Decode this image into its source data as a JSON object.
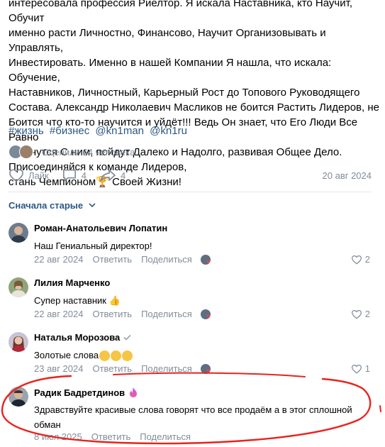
{
  "post": {
    "lines": [
      "интересовала профессия Риелтор. Я искала Наставника, кто Научит, Обучит",
      "именно расти Личностно, Финансово, Научит Организовывать и Управлять,",
      "Инвестировать. Именно в нашей Компании Я нашла, что искала: Обучение,",
      "Наставников, Личностный, Карьерный Рост до Топового Руководящего",
      "Состава. Александр Николаевич Масликов не боится Растить Лидеров, не",
      "Боится что кто-то научится и уйдёт!!! Ведь Он знает, что Его Люди Все Равно",
      "останутся С ним, пойдут Далеко и Надолго, развивая Общее Дело.",
      "Присоединяйся к команде Лидеров,"
    ],
    "last_line_before": "стань Чемпионом",
    "last_line_emoji": "🏆",
    "last_line_after": " Своей Жизни!",
    "tags": [
      "#жизнь",
      "#бизнес",
      "@kn1man",
      "@kn1ru"
    ],
    "likers_text": "Оценили 64 человека",
    "like_label": "Лайк",
    "comments_count": "4",
    "shares_count": "4",
    "date": "20 авг 2024"
  },
  "sort_label": "Сначала старые",
  "icons": {
    "like": "heart-outline-icon",
    "comment": "comment-bubble-icon",
    "share": "share-arrow-icon",
    "chevron": "chevron-down-icon",
    "verified": "check-icon",
    "fire": "fire-icon"
  },
  "colors": {
    "link": "#2a5885",
    "meta": "#818c99",
    "annotation": "#e8231f"
  },
  "comments": [
    {
      "name": "Роман-Анатольевич Лопатин",
      "text": "Наш Гениальный директор!",
      "date": "22 авг 2024",
      "reply": "Ответить",
      "share": "Поделиться",
      "likes": "2"
    },
    {
      "name": "Лилия Марченко",
      "text": "Супер наставник 👍",
      "date": "22 авг 2024",
      "reply": "Ответить",
      "share": "Поделиться",
      "likes": "2"
    },
    {
      "name": "Наталья Морозова",
      "text": "Золотые слова",
      "date": "23 авг 2024",
      "reply": "Ответить",
      "share": "Поделиться",
      "likes": "1"
    },
    {
      "name": "Радик Бадретдинов",
      "text": "Здравствуйте красивые слова говорят что все продаём а в этог сплошной обман",
      "date": "8 июл 2025",
      "reply": "Ответить",
      "share": "Поделиться",
      "likes": ""
    }
  ]
}
